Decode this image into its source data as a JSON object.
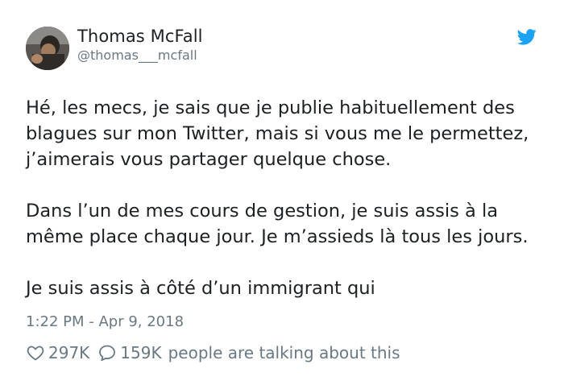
{
  "author": {
    "display_name": "Thomas McFall",
    "handle": "@thomas___mcfall"
  },
  "tweet": {
    "paragraphs": [
      "Hé, les mecs, je sais que je publie habituellement des\nblagues sur mon Twitter, mais si vous me le permettez,\nj’aimerais vous partager quelque chose.",
      "Dans l’un de mes cours de gestion, je suis assis à la\nmême place chaque jour. Je m’assieds là tous les jours.",
      "Je suis assis à côté d’un immigrant qui"
    ],
    "timestamp": "1:22 PM - Apr 9, 2018"
  },
  "stats": {
    "likes": "297K",
    "replies": "159K",
    "talking_label": "people are talking about this"
  },
  "icons": {
    "brand": "twitter-bird-icon",
    "like": "heart-icon",
    "reply": "reply-bubble-icon"
  },
  "colors": {
    "twitter_blue": "#1da1f2",
    "text": "#1c2022",
    "muted": "#697882"
  }
}
